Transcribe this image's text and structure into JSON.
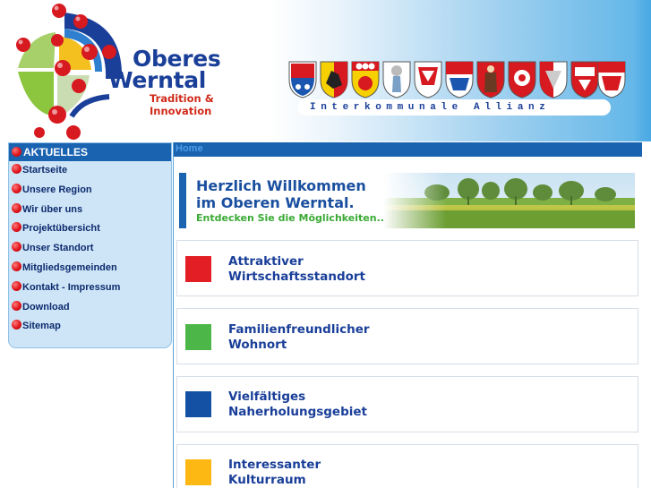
{
  "header": {
    "logo_title_line1": "Oberes",
    "logo_title_line2": "Werntal",
    "logo_tagline_line1": "Tradition &",
    "logo_tagline_line2": "Innovation",
    "alliance_text": "Interkommunale Allianz",
    "crest_count": 11
  },
  "sidebar": {
    "header_label": "AKTUELLES",
    "items": [
      {
        "label": "Startseite"
      },
      {
        "label": "Unsere Region"
      },
      {
        "label": "Wir über uns"
      },
      {
        "label": "Projektübersicht"
      },
      {
        "label": "Unser Standort"
      },
      {
        "label": "Mitgliedsgemeinden"
      },
      {
        "label": "Kontakt - Impressum"
      },
      {
        "label": "Download"
      },
      {
        "label": "Sitemap"
      }
    ]
  },
  "breadcrumb": {
    "home": "Home"
  },
  "welcome": {
    "line1": "Herzlich Willkommen",
    "line2": "im Oberen Werntal.",
    "line3": "Entdecken Sie die Möglichkeiten..."
  },
  "features": [
    {
      "line1": "Attraktiver",
      "line2": "Wirtschaftsstandort",
      "color": "#e31e24"
    },
    {
      "line1": "Familienfreundlicher",
      "line2": "Wohnort",
      "color": "#4cb748"
    },
    {
      "line1": "Vielfältiges",
      "line2": "Naherholungsgebiet",
      "color": "#1450a3"
    },
    {
      "line1": "Interessanter",
      "line2": "Kulturraum",
      "color": "#fdb813"
    }
  ],
  "colors": {
    "brand_blue": "#1a63b1",
    "brand_navy": "#1a3f99",
    "accent_red": "#e0141c",
    "sidebar_bg": "#cde5f6"
  }
}
